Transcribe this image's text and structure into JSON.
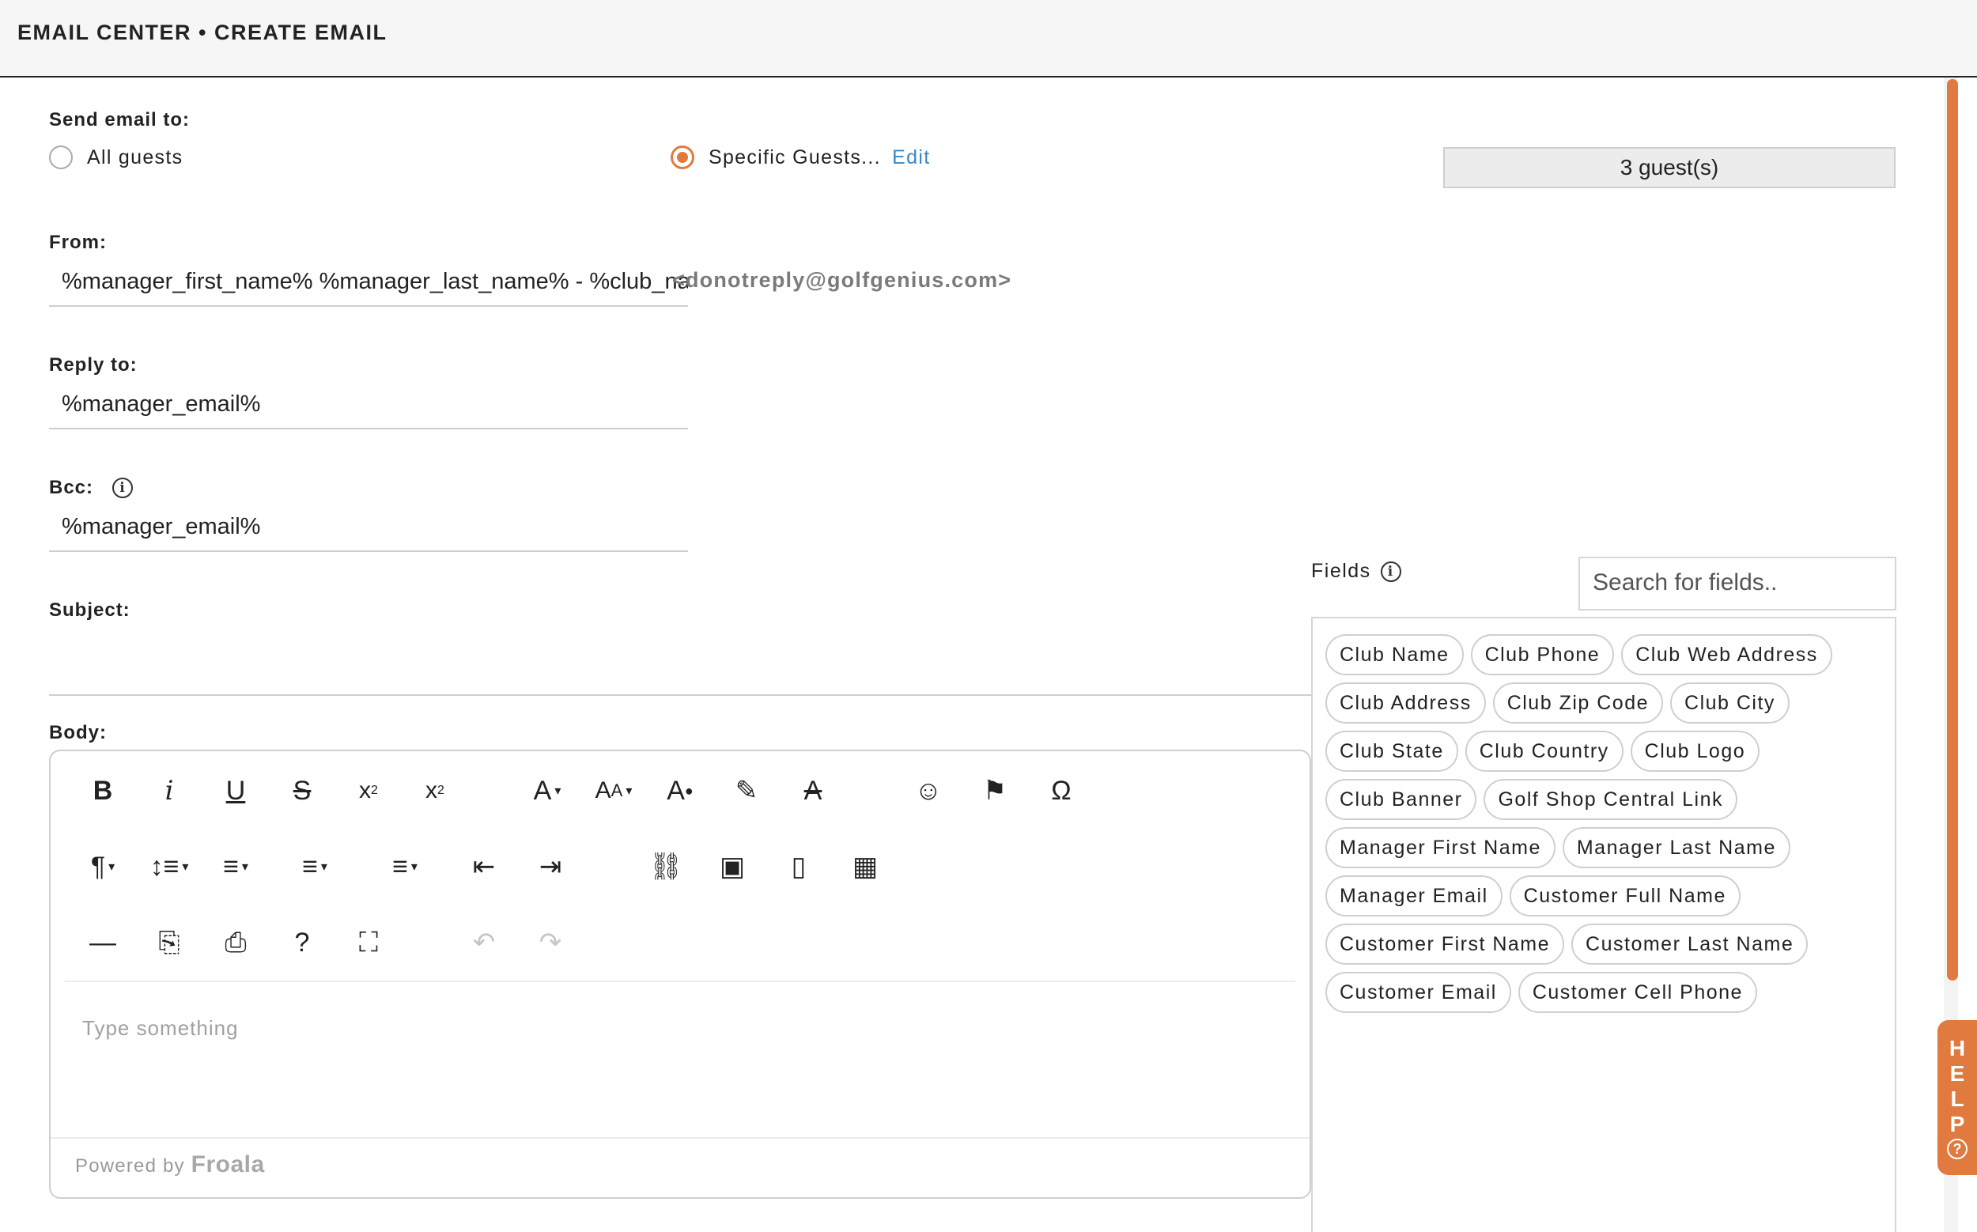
{
  "header": {
    "title": "EMAIL CENTER • CREATE EMAIL"
  },
  "recipients": {
    "label": "Send email to:",
    "options": [
      {
        "label": "All guests",
        "selected": false
      },
      {
        "label": "Specific Guests...",
        "selected": true
      }
    ],
    "edit_link": "Edit",
    "guest_count": "3 guest(s)"
  },
  "from": {
    "label": "From:",
    "value": "%manager_first_name% %manager_last_name% - %club_name%",
    "sender_address": "<donotreply@golfgenius.com>"
  },
  "reply_to": {
    "label": "Reply to:",
    "value": "%manager_email%"
  },
  "bcc": {
    "label": "Bcc:",
    "value": "%manager_email%",
    "info_icon": "info-icon"
  },
  "subject": {
    "label": "Subject:",
    "value": ""
  },
  "body": {
    "label": "Body:",
    "placeholder": "Type something",
    "powered_by": "Powered by",
    "brand": "Froala",
    "toolbar": {
      "row1": [
        {
          "name": "bold",
          "glyph": "B"
        },
        {
          "name": "italic",
          "glyph": "i"
        },
        {
          "name": "underline",
          "glyph": "U"
        },
        {
          "name": "strikethrough",
          "glyph": "S"
        },
        {
          "name": "subscript",
          "glyph": "x₂"
        },
        {
          "name": "superscript",
          "glyph": "x²"
        },
        {
          "name": "font-family",
          "glyph": "A"
        },
        {
          "name": "font-size",
          "glyph": "AA"
        },
        {
          "name": "text-color",
          "glyph": "A"
        },
        {
          "name": "background-color",
          "glyph": "✎"
        },
        {
          "name": "clear-formatting",
          "glyph": "A"
        },
        {
          "name": "emoticons",
          "glyph": "☺"
        },
        {
          "name": "flag",
          "glyph": "⚑"
        },
        {
          "name": "special-characters",
          "glyph": "Ω"
        }
      ],
      "row2": [
        {
          "name": "paragraph-format",
          "glyph": "¶"
        },
        {
          "name": "line-height",
          "glyph": "↕"
        },
        {
          "name": "align",
          "glyph": "≡"
        },
        {
          "name": "ordered-list",
          "glyph": "≡"
        },
        {
          "name": "unordered-list",
          "glyph": "≡"
        },
        {
          "name": "outdent",
          "glyph": "⇤"
        },
        {
          "name": "indent",
          "glyph": "⇥"
        },
        {
          "name": "insert-link",
          "glyph": "⛓"
        },
        {
          "name": "insert-image",
          "glyph": "▣"
        },
        {
          "name": "insert-file",
          "glyph": "▯"
        },
        {
          "name": "insert-table",
          "glyph": "▦"
        }
      ],
      "row3": [
        {
          "name": "insert-horizontal-line",
          "glyph": "—"
        },
        {
          "name": "export-pdf",
          "glyph": "⎘"
        },
        {
          "name": "print",
          "glyph": "⎙"
        },
        {
          "name": "help",
          "glyph": "?"
        },
        {
          "name": "fullscreen",
          "glyph": "⛶"
        },
        {
          "name": "undo",
          "glyph": "↶"
        },
        {
          "name": "redo",
          "glyph": "↷"
        }
      ]
    }
  },
  "fields": {
    "label": "Fields",
    "search_placeholder": "Search for fields..",
    "items": [
      "Club Name",
      "Club Phone",
      "Club Web Address",
      "Club Address",
      "Club Zip Code",
      "Club City",
      "Club State",
      "Club Country",
      "Club Logo",
      "Club Banner",
      "Golf Shop Central Link",
      "Manager First Name",
      "Manager Last Name",
      "Manager Email",
      "Customer Full Name",
      "Customer First Name",
      "Customer Last Name",
      "Customer Email",
      "Customer Cell Phone"
    ]
  },
  "help_tab": {
    "letters": [
      "H",
      "E",
      "L",
      "P"
    ],
    "icon": "question-circle-icon"
  },
  "colors": {
    "accent": "#e07a3f",
    "link": "#3b86c6"
  }
}
